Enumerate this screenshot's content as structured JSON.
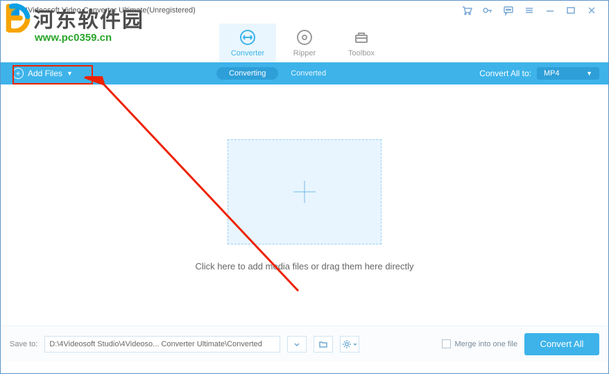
{
  "titlebar": {
    "title": "4Videosoft Video Converter Ultimate(Unregistered)"
  },
  "watermark": {
    "cn": "河东软件园",
    "url": "www.pc0359.cn"
  },
  "main_tabs": {
    "converter": "Converter",
    "ripper": "Ripper",
    "toolbox": "Toolbox"
  },
  "toolbar": {
    "add_files": "Add Files",
    "converting": "Converting",
    "converted": "Converted",
    "convert_all_to": "Convert All to:",
    "format": "MP4"
  },
  "content": {
    "drop_text": "Click here to add media files or drag them here directly"
  },
  "bottombar": {
    "save_to": "Save to:",
    "path": "D:\\4Videosoft Studio\\4Videoso... Converter Ultimate\\Converted",
    "merge": "Merge into one file",
    "convert_all": "Convert All"
  }
}
